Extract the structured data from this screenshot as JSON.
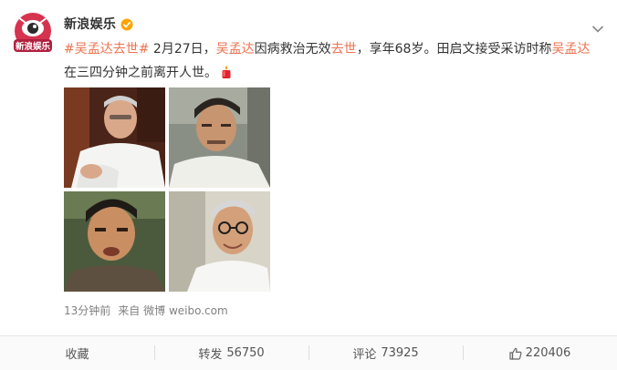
{
  "post": {
    "username": "新浪娱乐",
    "avatar_text": "新浪娱乐",
    "text_segments": {
      "hashtag": "#吴孟达去世#",
      "t1": " 2月27日，",
      "name1": "吴孟达",
      "t2": "因病救治无效",
      "died": "去世",
      "t3": "，享年68岁。田启文接受采访时称",
      "name2": "吴孟达",
      "t4": "在三四分钟之前离开人世。"
    },
    "time": "13分钟前",
    "source_prefix": "来自",
    "source": "微博 weibo.com"
  },
  "actions": {
    "collect_label": "收藏",
    "repost_label": "转发",
    "repost_count": "56750",
    "comment_label": "评论",
    "comment_count": "73925",
    "like_count": "220406"
  },
  "icons": {
    "verified": "verified-badge-icon",
    "chevron": "chevron-down-icon",
    "candle": "candle-emoji-icon",
    "like": "thumbs-up-icon"
  },
  "colors": {
    "highlight": "#eb7350",
    "verified": "#ffa400",
    "avatar_bg": "#d6334f"
  }
}
